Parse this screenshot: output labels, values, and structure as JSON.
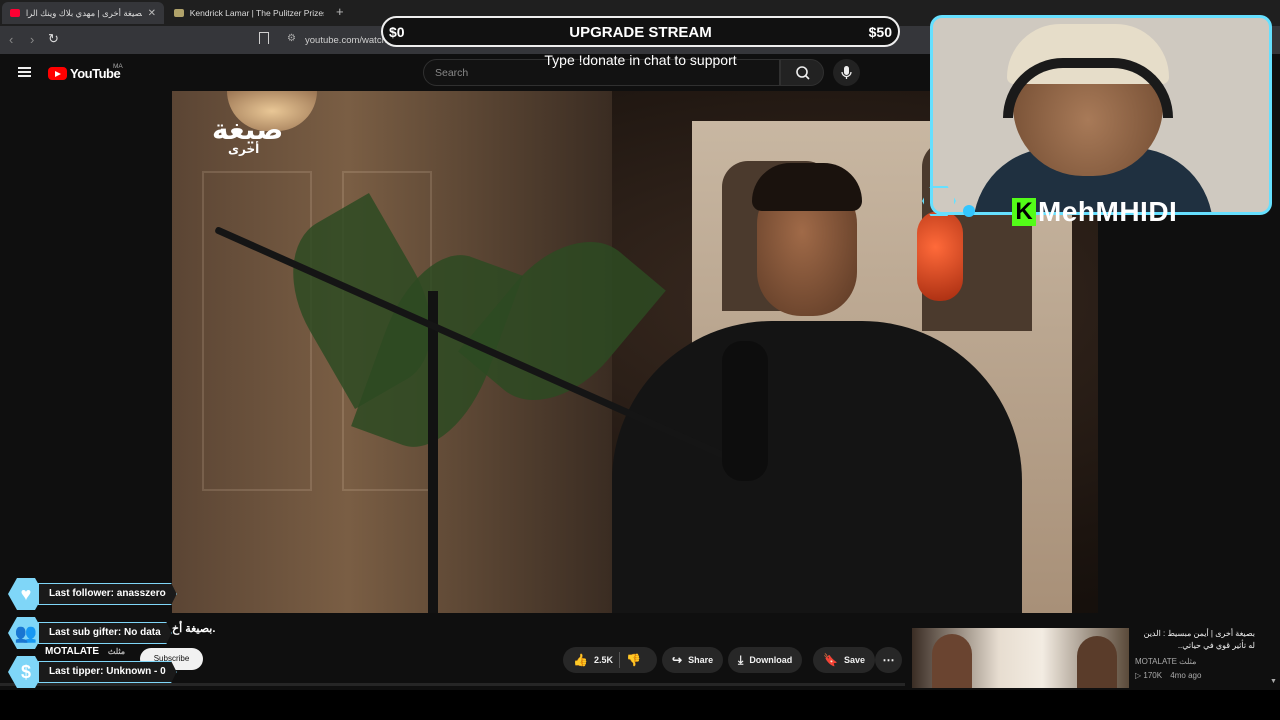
{
  "browser": {
    "tabs": [
      {
        "label": "بصيغة أخرى | مهدي بلاك وينك الرا",
        "active": true,
        "favicon_color": "#ff0033"
      },
      {
        "label": "Kendrick Lamar | The Pulitzer Prizes",
        "active": false,
        "favicon_color": "#b0a26a"
      }
    ],
    "url": "youtube.com/watch?v=8ybW-pgkYPA"
  },
  "youtube": {
    "logo_text": "YouTube",
    "country_code": "MA",
    "search_placeholder": "Search"
  },
  "overlay": {
    "upgrade_low": "$0",
    "upgrade_title": "UPGRADE STREAM",
    "upgrade_high": "$50",
    "upgrade_sub": "Type !donate in chat to support",
    "streamer_name": "MehMHIDI",
    "accent_color": "#66e0ff",
    "kick_color": "#53fc18",
    "kick_letter": "K"
  },
  "video": {
    "watermark_main": "صيغة",
    "watermark_sub": "أخرى",
    "title": ".بصيغة أخ",
    "channel": "MOTALATE",
    "channel_suffix": "مثلث",
    "subscribe_label": "Subscribe",
    "likes": "2.5K",
    "share_label": "Share",
    "download_label": "Download",
    "save_label": "Save"
  },
  "events": {
    "follower": "Last follower: anasszero",
    "sub_gifter": "Last sub gifter: No data",
    "tipper": "Last tipper: Unknown - 0"
  },
  "recommendation": {
    "title": "بصيغة أخرى | أيمن مبسيط : الدين له تأثير قوي في حياتي..",
    "channel": "MOTALATE مثلث",
    "views": "170K",
    "age": "4mo ago"
  }
}
